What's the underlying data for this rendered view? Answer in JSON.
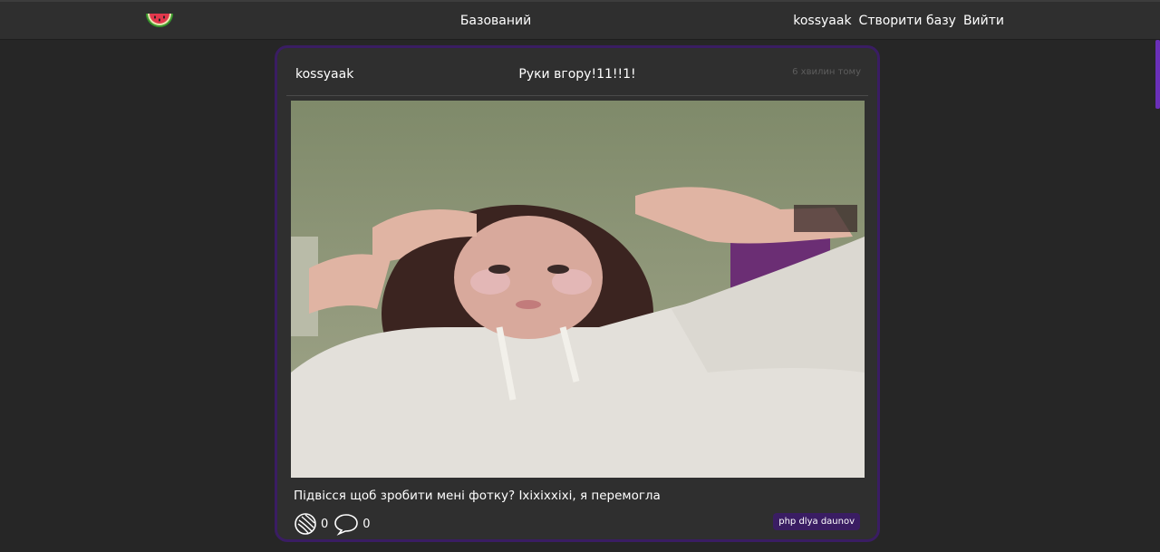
{
  "header": {
    "title": "Базований",
    "logo_icon": "watermelon-icon",
    "nav": {
      "username": "kossyaak",
      "create_db": "Створити базу",
      "logout": "Вийти"
    }
  },
  "post": {
    "author": "kossyaak",
    "title": "Руки вгору!11!!1!",
    "time_ago": "6 хвилин тому",
    "caption": "Підвісся щоб зробити мені фотку? Іхіхіхxіхі, я перемогла",
    "like_icon": "watermelon-slice-icon",
    "likes": "0",
    "comment_icon": "speech-bubble-icon",
    "comments": "0",
    "tag": "php dlya daunov"
  },
  "colors": {
    "background": "#262626",
    "bar": "#2f2f2f",
    "accent": "#3a1d63",
    "scroll_accent": "#6a2fb8",
    "muted_text": "#5d5d5d"
  }
}
